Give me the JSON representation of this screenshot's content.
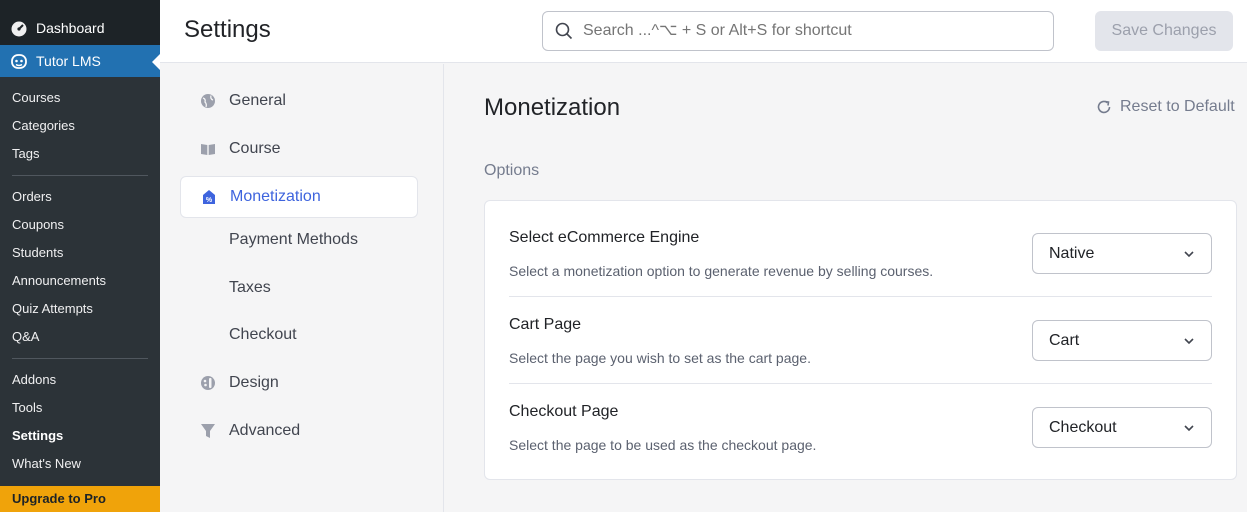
{
  "wp_menu": {
    "dashboard": "Dashboard",
    "plugin": "Tutor LMS",
    "submenu_group1": [
      "Courses",
      "Categories",
      "Tags"
    ],
    "submenu_group2": [
      "Orders",
      "Coupons",
      "Students",
      "Announcements",
      "Quiz Attempts",
      "Q&A"
    ],
    "submenu_group3": [
      "Addons",
      "Tools",
      "Settings",
      "What's New"
    ],
    "upgrade": "Upgrade to Pro",
    "active_color": "#2271b1",
    "upgrade_color": "#f0a30a"
  },
  "header": {
    "title": "Settings",
    "search_placeholder": "Search ...^⌥ + S or Alt+S for shortcut",
    "save_label": "Save Changes"
  },
  "settings_nav": {
    "items": [
      {
        "label": "General",
        "icon": "globe-icon"
      },
      {
        "label": "Course",
        "icon": "book-icon"
      },
      {
        "label": "Monetization",
        "icon": "monetization-icon",
        "active": true
      },
      {
        "label": "Design",
        "icon": "palette-icon"
      },
      {
        "label": "Advanced",
        "icon": "filter-icon"
      }
    ],
    "subitems": [
      "Payment Methods",
      "Taxes",
      "Checkout"
    ],
    "accent": "#3e64de"
  },
  "main": {
    "section_title": "Monetization",
    "reset_label": "Reset to Default",
    "options_label": "Options",
    "options": [
      {
        "title": "Select eCommerce Engine",
        "desc": "Select a monetization option to generate revenue by selling courses.",
        "value": "Native"
      },
      {
        "title": "Cart Page",
        "desc": "Select the page you wish to set as the cart page.",
        "value": "Cart"
      },
      {
        "title": "Checkout Page",
        "desc": "Select the page to be used as the checkout page.",
        "value": "Checkout"
      }
    ]
  }
}
